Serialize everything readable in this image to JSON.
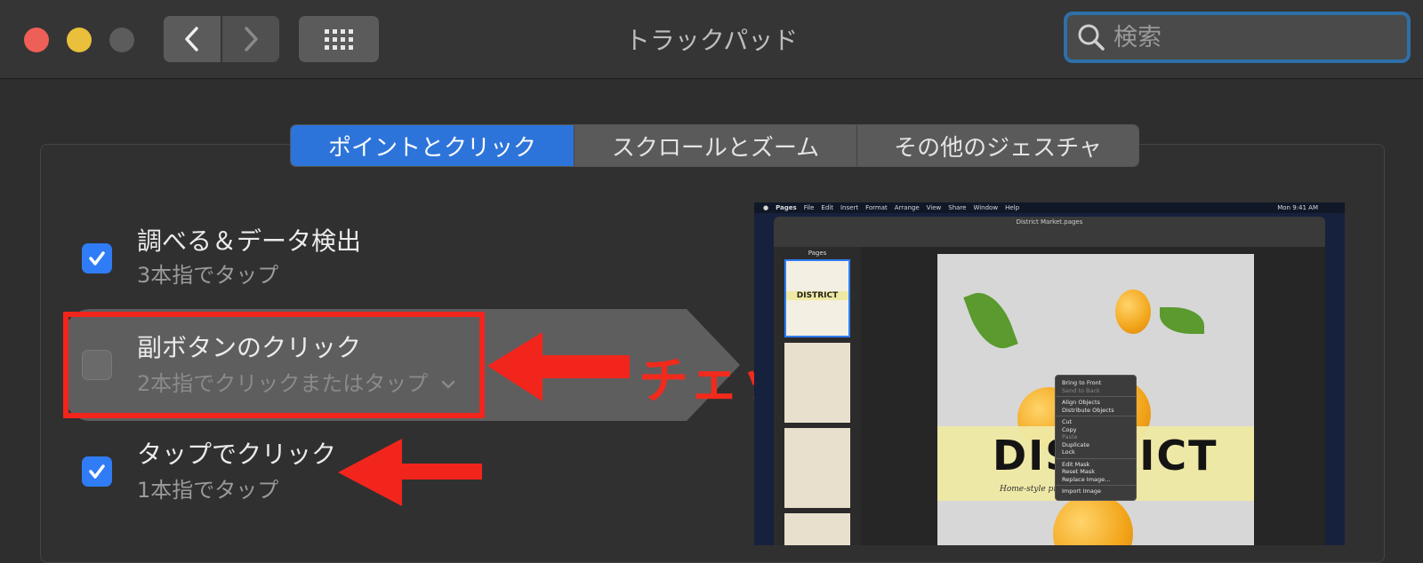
{
  "window": {
    "title": "トラックパッド",
    "search_placeholder": "検索"
  },
  "tabs": [
    {
      "label": "ポイントとクリック",
      "active": true
    },
    {
      "label": "スクロールとズーム",
      "active": false
    },
    {
      "label": "その他のジェスチャ",
      "active": false
    }
  ],
  "settings": [
    {
      "title": "調べる＆データ検出",
      "subtitle": "3本指でタップ",
      "checked": true
    },
    {
      "title": "副ボタンのクリック",
      "subtitle": "2本指でクリックまたはタップ",
      "checked": false
    },
    {
      "title": "タップでクリック",
      "subtitle": "1本指でタップ",
      "checked": true
    }
  ],
  "annotation": {
    "callout": "チェックが外れていませんか？",
    "color": "#f22a1c"
  },
  "preview": {
    "menubar": [
      "Pages",
      "File",
      "Edit",
      "Insert",
      "Format",
      "Arrange",
      "View",
      "Share",
      "Window",
      "Help"
    ],
    "clock": "Mon 9:41 AM",
    "doc_title": "District Market.pages",
    "sidebar_title": "Pages",
    "thumb_label": "DISTRICT",
    "cover_title": "DISTRICT",
    "tagline": "Home-style pr ... for your kitchen",
    "context_menu": [
      "Bring to Front",
      "Send to Back",
      "Align Objects",
      "Distribute Objects",
      "Cut",
      "Copy",
      "Paste",
      "Duplicate",
      "Lock",
      "Edit Mask",
      "Reset Mask",
      "Replace Image...",
      "Import Image"
    ]
  },
  "colors": {
    "accent": "#2d74da",
    "checkbox_on": "#2f7cf6",
    "highlight_red": "#f2251c"
  }
}
